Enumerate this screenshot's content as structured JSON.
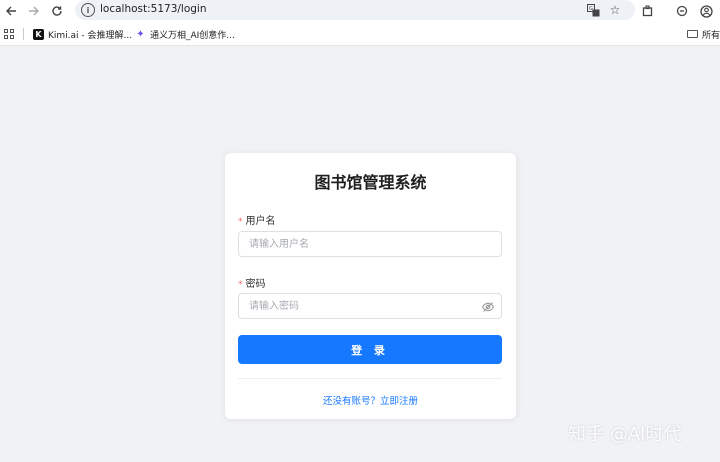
{
  "browser": {
    "url": "localhost:5173/login",
    "bookmarks": [
      {
        "icon": "kimi-logo",
        "label": "Kimi.ai - 会推理解..."
      },
      {
        "icon": "tongyi-logo",
        "label": "通义万相_AI创意作..."
      }
    ],
    "all_bookmarks_label": "所有"
  },
  "login": {
    "title": "图书馆管理系统",
    "username_label": "用户名",
    "username_placeholder": "请输入用户名",
    "password_label": "密码",
    "password_placeholder": "请输入密码",
    "required_mark": "*",
    "submit_label": "登 录",
    "register_link": "还没有账号？立即注册"
  },
  "watermark": "知乎 @AI时代",
  "colors": {
    "primary": "#1677ff",
    "page_background": "#f0f2f5",
    "required": "#f56c6c"
  }
}
